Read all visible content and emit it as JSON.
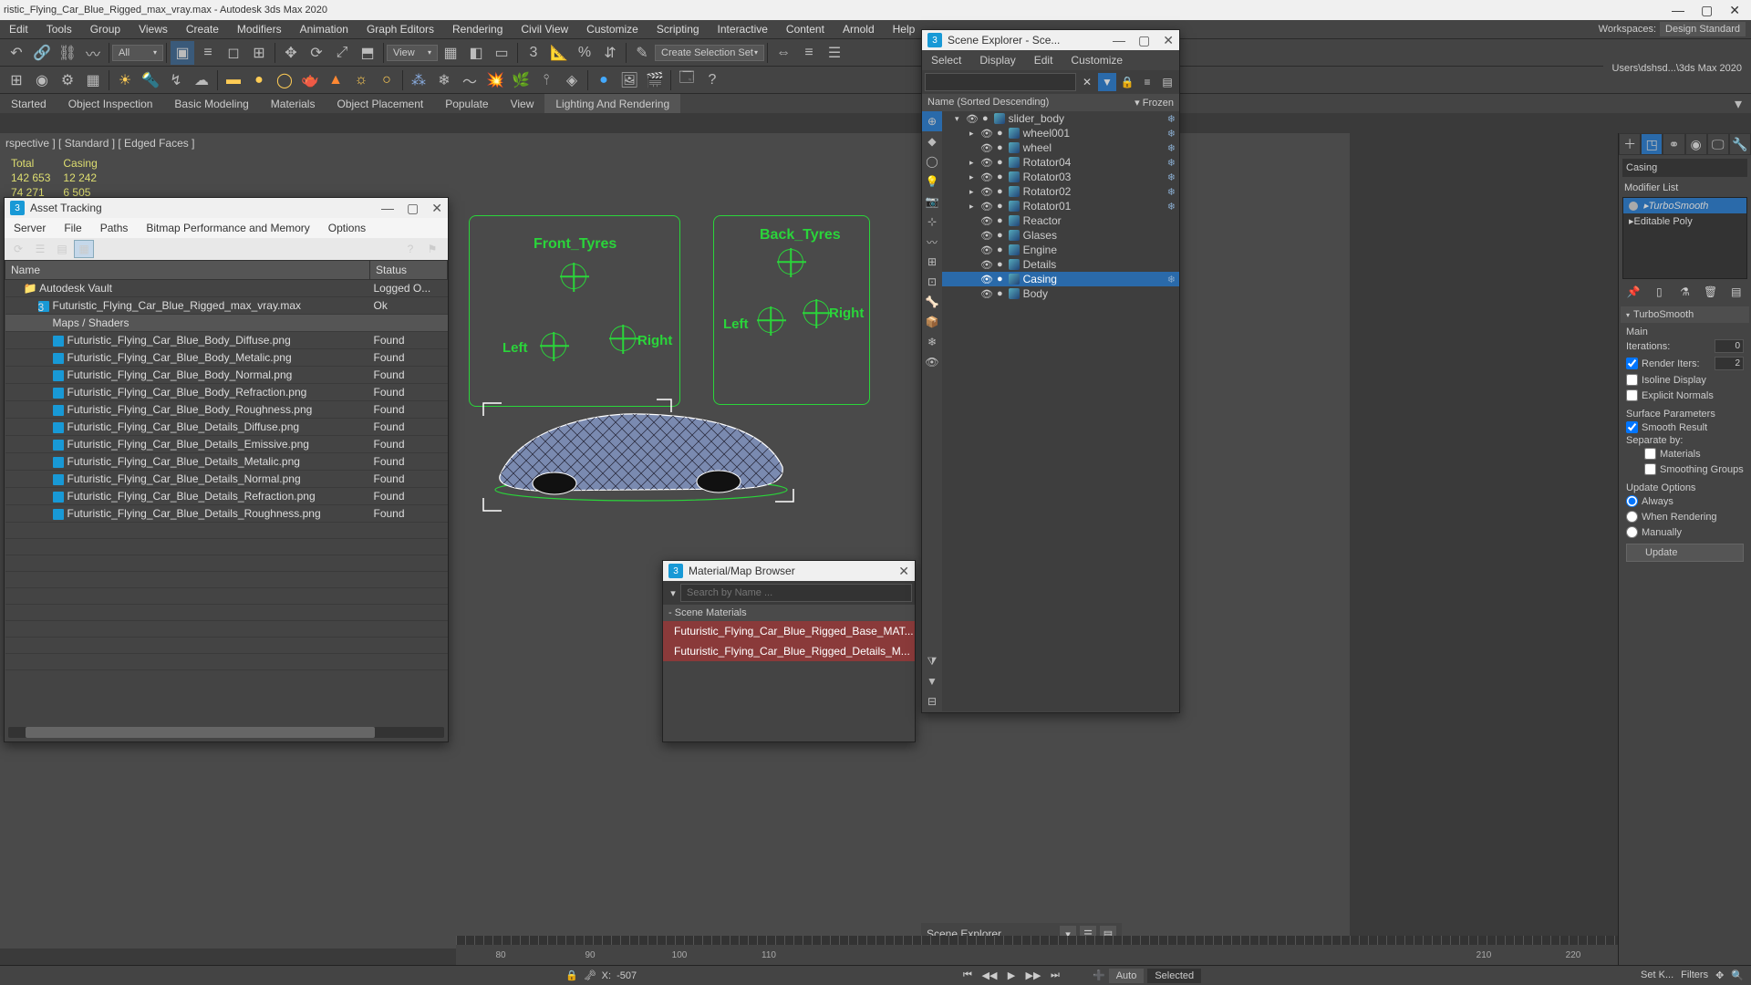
{
  "app": {
    "title_prefix": "ristic_Flying_Car_Blue_Rigged_max_vray.max - Autodesk 3ds Max 2020"
  },
  "menu": [
    "Edit",
    "Tools",
    "Group",
    "Views",
    "Create",
    "Modifiers",
    "Animation",
    "Graph Editors",
    "Rendering",
    "Civil View",
    "Customize",
    "Scripting",
    "Interactive",
    "Content",
    "Arnold",
    "Help"
  ],
  "workspace": {
    "label": "Workspaces:",
    "value": "Design Standard",
    "recent_path": "Users\\dshsd...\\3ds Max 2020"
  },
  "toolbar1": {
    "filter": "All",
    "viewlabel": "View",
    "selection_set": "Create Selection Set"
  },
  "ribbon": [
    "Started",
    "Object Inspection",
    "Basic Modeling",
    "Materials",
    "Object Placement",
    "Populate",
    "View",
    "Lighting And Rendering"
  ],
  "ribbon_active": 7,
  "viewport": {
    "label": "rspective ] [ Standard ] [ Edged Faces ]",
    "stats": {
      "h_total": "Total",
      "h_casing": "Casing",
      "verts_total": "142 653",
      "verts_casing": "12 242",
      "polys_total": "74 271",
      "polys_casing": "6 505"
    },
    "rig": {
      "front": "Front_Tyres",
      "back": "Back_Tyres",
      "left": "Left",
      "right": "Right"
    }
  },
  "asset": {
    "title": "Asset Tracking",
    "menu": [
      "Server",
      "File",
      "Paths",
      "Bitmap Performance and Memory",
      "Options"
    ],
    "col_name": "Name",
    "col_status": "Status",
    "vault": "Autodesk Vault",
    "vault_status": "Logged O...",
    "scene": "Futuristic_Flying_Car_Blue_Rigged_max_vray.max",
    "scene_status": "Ok",
    "maps_header": "Maps / Shaders",
    "rows": [
      {
        "n": "Futuristic_Flying_Car_Blue_Body_Diffuse.png",
        "s": "Found"
      },
      {
        "n": "Futuristic_Flying_Car_Blue_Body_Metalic.png",
        "s": "Found"
      },
      {
        "n": "Futuristic_Flying_Car_Blue_Body_Normal.png",
        "s": "Found"
      },
      {
        "n": "Futuristic_Flying_Car_Blue_Body_Refraction.png",
        "s": "Found"
      },
      {
        "n": "Futuristic_Flying_Car_Blue_Body_Roughness.png",
        "s": "Found"
      },
      {
        "n": "Futuristic_Flying_Car_Blue_Details_Diffuse.png",
        "s": "Found"
      },
      {
        "n": "Futuristic_Flying_Car_Blue_Details_Emissive.png",
        "s": "Found"
      },
      {
        "n": "Futuristic_Flying_Car_Blue_Details_Metalic.png",
        "s": "Found"
      },
      {
        "n": "Futuristic_Flying_Car_Blue_Details_Normal.png",
        "s": "Found"
      },
      {
        "n": "Futuristic_Flying_Car_Blue_Details_Refraction.png",
        "s": "Found"
      },
      {
        "n": "Futuristic_Flying_Car_Blue_Details_Roughness.png",
        "s": "Found"
      }
    ]
  },
  "material": {
    "title": "Material/Map Browser",
    "search_ph": "Search by Name ...",
    "section": "Scene Materials",
    "items": [
      "Futuristic_Flying_Car_Blue_Rigged_Base_MAT...",
      "Futuristic_Flying_Car_Blue_Rigged_Details_M..."
    ]
  },
  "scene": {
    "title": "Scene Explorer - Sce...",
    "bottom_label": "Scene Explorer",
    "menu": [
      "Select",
      "Display",
      "Edit",
      "Customize"
    ],
    "col_name": "Name (Sorted Descending)",
    "col_frozen": "Frozen",
    "nodes": [
      {
        "d": 1,
        "name": "slider_body",
        "arrow": "▾",
        "freeze": true,
        "sel": false
      },
      {
        "d": 2,
        "name": "wheel001",
        "arrow": "▸",
        "freeze": true,
        "sel": false
      },
      {
        "d": 2,
        "name": "wheel",
        "arrow": "",
        "freeze": true,
        "sel": false
      },
      {
        "d": 2,
        "name": "Rotator04",
        "arrow": "▸",
        "freeze": true,
        "sel": false
      },
      {
        "d": 2,
        "name": "Rotator03",
        "arrow": "▸",
        "freeze": true,
        "sel": false
      },
      {
        "d": 2,
        "name": "Rotator02",
        "arrow": "▸",
        "freeze": true,
        "sel": false
      },
      {
        "d": 2,
        "name": "Rotator01",
        "arrow": "▸",
        "freeze": true,
        "sel": false
      },
      {
        "d": 2,
        "name": "Reactor",
        "arrow": "",
        "freeze": false,
        "sel": false
      },
      {
        "d": 2,
        "name": "Glases",
        "arrow": "",
        "freeze": false,
        "sel": false
      },
      {
        "d": 2,
        "name": "Engine",
        "arrow": "",
        "freeze": false,
        "sel": false
      },
      {
        "d": 2,
        "name": "Details",
        "arrow": "",
        "freeze": false,
        "sel": false
      },
      {
        "d": 2,
        "name": "Casing",
        "arrow": "",
        "freeze": true,
        "sel": true
      },
      {
        "d": 2,
        "name": "Body",
        "arrow": "",
        "freeze": false,
        "sel": false
      }
    ]
  },
  "command": {
    "objname": "Casing",
    "modlist_label": "Modifier List",
    "mods": [
      {
        "name": "TurboSmooth",
        "sel": true
      },
      {
        "name": "Editable Poly",
        "sel": false
      }
    ],
    "turbosmooth": {
      "title": "TurboSmooth",
      "main": "Main",
      "iterations_l": "Iterations:",
      "iterations": "0",
      "render_iters_l": "Render Iters:",
      "render_iters": "2",
      "isoline": "Isoline Display",
      "explicit": "Explicit Normals",
      "surface_params": "Surface Parameters",
      "smooth_result": "Smooth Result",
      "separate_by": "Separate by:",
      "by_materials": "Materials",
      "by_groups": "Smoothing Groups",
      "update_options": "Update Options",
      "always": "Always",
      "when_rendering": "When Rendering",
      "manually": "Manually",
      "update_btn": "Update"
    }
  },
  "timeline": {
    "ticks": [
      "80",
      "90",
      "100",
      "110",
      "",
      "",
      "",
      "",
      "",
      "",
      "",
      "210",
      "220"
    ]
  },
  "status": {
    "x": "X:",
    "xval": "-507",
    "auto": "Auto",
    "selected": "Selected",
    "setk": "Set K...",
    "filters": "Filters"
  }
}
